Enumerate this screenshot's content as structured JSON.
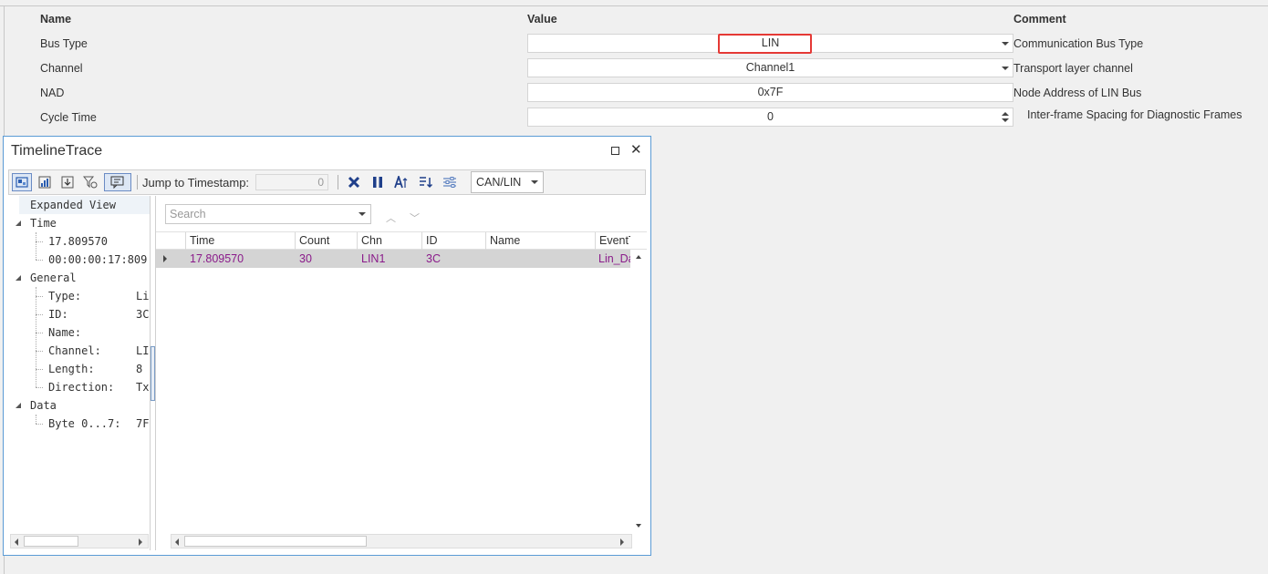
{
  "property_grid": {
    "headers": {
      "name": "Name",
      "value": "Value",
      "comment": "Comment"
    },
    "rows": [
      {
        "name": "Bus Type",
        "value": "LIN",
        "comment": "Communication Bus Type",
        "control": "dropdown"
      },
      {
        "name": "Channel",
        "value": "Channel1",
        "comment": "Transport layer channel",
        "control": "dropdown"
      },
      {
        "name": "NAD",
        "value": "0x7F",
        "comment": "Node Address of LIN Bus",
        "control": "text"
      },
      {
        "name": "Cycle Time",
        "value": "0",
        "comment": "Inter-frame Spacing for Diagnostic Frames",
        "control": "spinner"
      }
    ],
    "highlight_color": "#e53935"
  },
  "timeline": {
    "title": "TimelineTrace",
    "toolbar": {
      "jump_label": "Jump to Timestamp:",
      "jump_value": "0",
      "bus_filter": "CAN/LIN",
      "icons": [
        "view-icon",
        "chart-icon",
        "export-icon",
        "filter-icon",
        "comment-icon",
        "clear-icon",
        "pause-icon",
        "font-icon",
        "sort-icon",
        "settings-icon"
      ]
    },
    "tree": {
      "expanded_view": "Expanded View",
      "time_group": "Time",
      "time_values": [
        "17.809570",
        "00:00:00:17:809"
      ],
      "general_group": "General",
      "general_items": [
        {
          "key": "Type:",
          "value": "Li"
        },
        {
          "key": "ID:",
          "value": "3C"
        },
        {
          "key": "Name:",
          "value": ""
        },
        {
          "key": "Channel:",
          "value": "LI"
        },
        {
          "key": "Length:",
          "value": "8"
        },
        {
          "key": "Direction:",
          "value": "Tx"
        }
      ],
      "data_group": "Data",
      "data_items": [
        {
          "key": "Byte 0...7:",
          "value": "7F"
        }
      ]
    },
    "grid": {
      "search_placeholder": "Search",
      "columns": [
        "Time",
        "Count",
        "Chn",
        "ID",
        "Name",
        "EventT"
      ],
      "rows": [
        {
          "time": "17.809570",
          "count": "30",
          "chn": "LIN1",
          "id": "3C",
          "name": "",
          "event": "Lin_Da"
        }
      ],
      "row_text_color": "#8a1a8a",
      "row_bg_color": "#d4d4d4"
    },
    "accent_color": "#5b9bd5"
  }
}
